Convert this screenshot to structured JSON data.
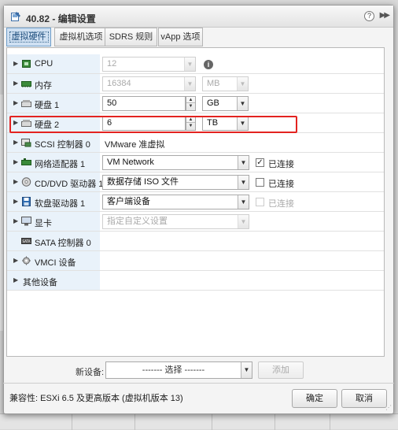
{
  "dialog": {
    "title": "40.82 - 编辑设置",
    "help_icon": "?"
  },
  "tabs": [
    {
      "label": "虚拟硬件",
      "active": true
    },
    {
      "label": "虚拟机选项",
      "active": false
    },
    {
      "label": "SDRS 规则",
      "active": false
    },
    {
      "label": "vApp 选项",
      "active": false
    }
  ],
  "hardware": {
    "cpu": {
      "label": "CPU",
      "value": "12",
      "icon": "cpu-icon"
    },
    "memory": {
      "label": "内存",
      "value": "16384",
      "unit": "MB",
      "icon": "memory-icon"
    },
    "disk1": {
      "label": "硬盘 1",
      "value": "50",
      "unit": "GB",
      "icon": "hard-disk-icon"
    },
    "disk2": {
      "label": "硬盘 2",
      "value": "6",
      "unit": "TB",
      "icon": "hard-disk-icon"
    },
    "scsi": {
      "label": "SCSI 控制器 0",
      "value": "VMware 准虚拟",
      "icon": "scsi-controller-icon"
    },
    "network": {
      "label": "网络适配器 1",
      "value": "VM Network",
      "checkbox_label": "已连接",
      "checked": true,
      "icon": "network-adapter-icon"
    },
    "cdrom": {
      "label": "CD/DVD 驱动器 1",
      "value": "数据存储 ISO 文件",
      "checkbox_label": "已连接",
      "checked": false,
      "icon": "cdrom-icon"
    },
    "floppy": {
      "label": "软盘驱动器 1",
      "value": "客户端设备",
      "checkbox_label": "已连接",
      "checked": false,
      "icon": "floppy-icon"
    },
    "video": {
      "label": "显卡",
      "value": "指定自定义设置",
      "icon": "video-card-icon"
    },
    "sata": {
      "label": "SATA 控制器 0",
      "icon": "sata-controller-icon"
    },
    "vmci": {
      "label": "VMCI 设备",
      "icon": "vmci-device-icon"
    },
    "other": {
      "label": "其他设备"
    }
  },
  "new_device": {
    "label": "新设备:",
    "select_value": "------- 选择 -------",
    "add_label": "添加"
  },
  "footer": {
    "compatibility": "兼容性: ESXi 6.5 及更高版本 (虚拟机版本 13)",
    "ok_label": "确定",
    "cancel_label": "取消"
  },
  "colors": {
    "highlight": "#e32320",
    "label_column": "#e9f2fa",
    "active_tab": "#cfe0f2"
  }
}
